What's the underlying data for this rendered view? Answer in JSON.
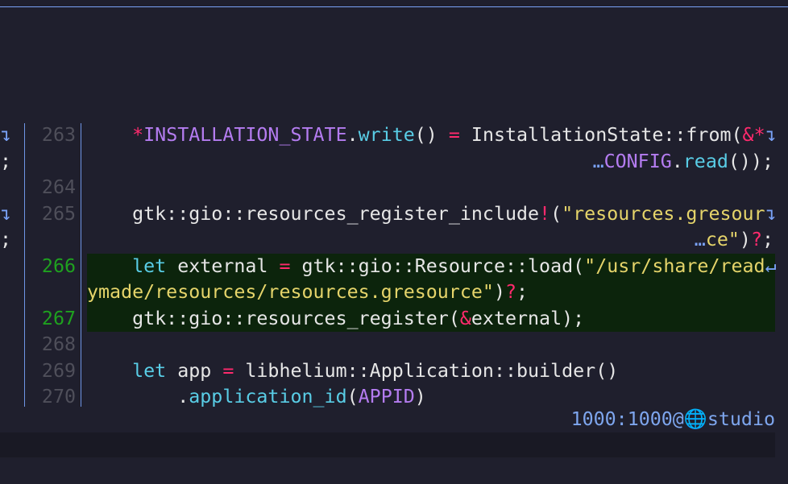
{
  "gutter": {
    "wrap_icon": "↴",
    "semi": ";"
  },
  "lines": [
    {
      "num": "263",
      "tokens": [
        [
          "p",
          "*"
        ],
        [
          "v",
          "INSTALLATION_STATE"
        ],
        [
          "w",
          "."
        ],
        [
          "c",
          "write"
        ],
        [
          "w",
          "() "
        ],
        [
          "p",
          "="
        ],
        [
          "w",
          " InstallationState::from("
        ],
        [
          "p",
          "&*"
        ],
        [
          "a",
          "↴"
        ]
      ],
      "cont": [
        [
          "a",
          "…"
        ],
        [
          "v",
          "CONFIG"
        ],
        [
          "w",
          "."
        ],
        [
          "c",
          "read"
        ],
        [
          "w",
          "());"
        ]
      ]
    },
    {
      "num": "264",
      "tokens": []
    },
    {
      "num": "265",
      "tokens": [
        [
          "w",
          "gtk::gio::resources_register_include"
        ],
        [
          "p",
          "!"
        ],
        [
          "w",
          "("
        ],
        [
          "s",
          "\"resources.gresour"
        ],
        [
          "a",
          "↴"
        ]
      ],
      "cont": [
        [
          "a",
          "…"
        ],
        [
          "s",
          "ce\""
        ],
        [
          "w",
          ")"
        ],
        [
          "p",
          "?"
        ],
        [
          "w",
          ";"
        ]
      ]
    },
    {
      "num": "266",
      "tokens": [
        [
          "c",
          "let"
        ],
        [
          "w",
          " external "
        ],
        [
          "p",
          "="
        ],
        [
          "w",
          " gtk::gio::Resource::load("
        ],
        [
          "s",
          "\"/usr/share/read"
        ],
        [
          "a",
          "↵"
        ]
      ],
      "wrap": [
        [
          "s",
          "ymade/resources/resources.gresource\""
        ],
        [
          "w",
          ")"
        ],
        [
          "p",
          "?"
        ],
        [
          "w",
          ";"
        ]
      ]
    },
    {
      "num": "267",
      "tokens": [
        [
          "w",
          "gtk::gio::resources_register("
        ],
        [
          "p",
          "&"
        ],
        [
          "w",
          "external);"
        ]
      ]
    },
    {
      "num": "268",
      "tokens": []
    },
    {
      "num": "269",
      "tokens": [
        [
          "c",
          "let"
        ],
        [
          "w",
          " app "
        ],
        [
          "p",
          "="
        ],
        [
          "w",
          " libhelium::Application::builder()"
        ]
      ]
    },
    {
      "num": "270",
      "tokens": [
        [
          "w",
          "    ."
        ],
        [
          "c",
          "application_id"
        ],
        [
          "w",
          "("
        ],
        [
          "v",
          "APPID"
        ],
        [
          "w",
          ")"
        ]
      ]
    }
  ],
  "current_lines": [
    "266",
    "267"
  ],
  "status": {
    "user": "1000:1000@",
    "icon": "globe-icon",
    "host": "studio"
  }
}
